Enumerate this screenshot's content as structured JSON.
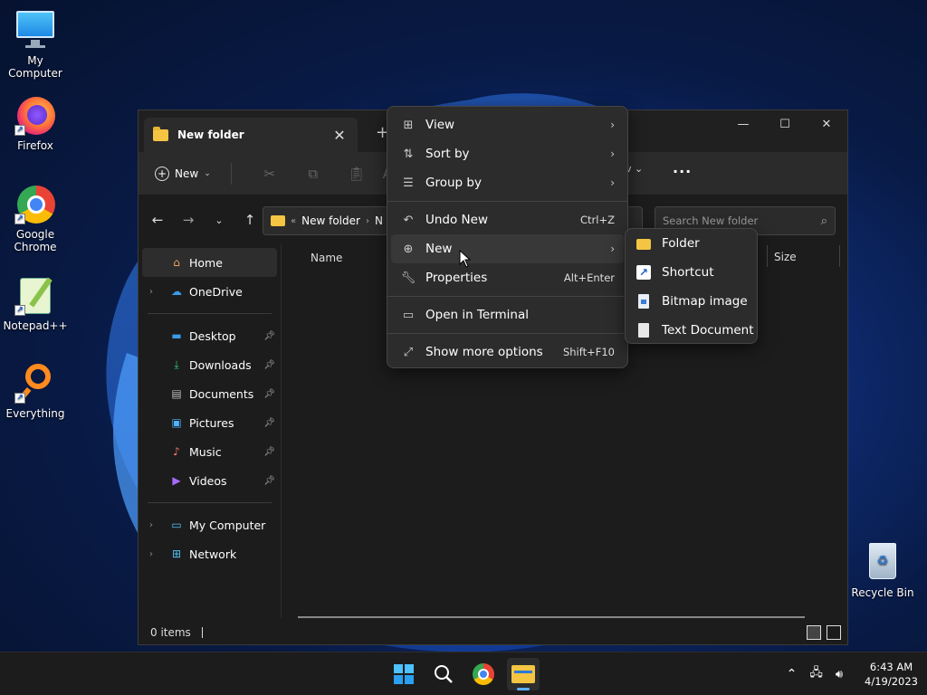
{
  "desktop": {
    "icons": [
      {
        "label": "My Computer"
      },
      {
        "label": "Firefox"
      },
      {
        "label": "Google Chrome"
      },
      {
        "label": "Notepad++"
      },
      {
        "label": "Everything"
      },
      {
        "label": "Recycle Bin"
      }
    ]
  },
  "window": {
    "tab_title": "New folder",
    "toolbar": {
      "new_label": "New",
      "view_fragment": "v"
    },
    "address": {
      "crumb": "New folder",
      "crumb_next": "N"
    },
    "search_placeholder": "Search New folder",
    "columns": {
      "name": "Name",
      "size": "Size"
    },
    "sidebar": {
      "home": "Home",
      "onedrive": "OneDrive",
      "quick": [
        "Desktop",
        "Downloads",
        "Documents",
        "Pictures",
        "Music",
        "Videos"
      ],
      "my_computer": "My Computer",
      "network": "Network"
    },
    "status": "0 items"
  },
  "context_menu": {
    "items": [
      {
        "label": "View",
        "shortcut": ""
      },
      {
        "label": "Sort by",
        "shortcut": ""
      },
      {
        "label": "Group by",
        "shortcut": ""
      },
      {
        "label": "Undo New",
        "shortcut": "Ctrl+Z"
      },
      {
        "label": "New",
        "shortcut": ""
      },
      {
        "label": "Properties",
        "shortcut": "Alt+Enter"
      },
      {
        "label": "Open in Terminal",
        "shortcut": ""
      },
      {
        "label": "Show more options",
        "shortcut": "Shift+F10"
      }
    ],
    "submenu": [
      "Folder",
      "Shortcut",
      "Bitmap image",
      "Text Document"
    ]
  },
  "taskbar": {
    "time": "6:43 AM",
    "date": "4/19/2023"
  },
  "colors": {
    "accent": "#5eb0ff",
    "folder": "#f4c542",
    "menu_bg": "#2c2c2c"
  }
}
